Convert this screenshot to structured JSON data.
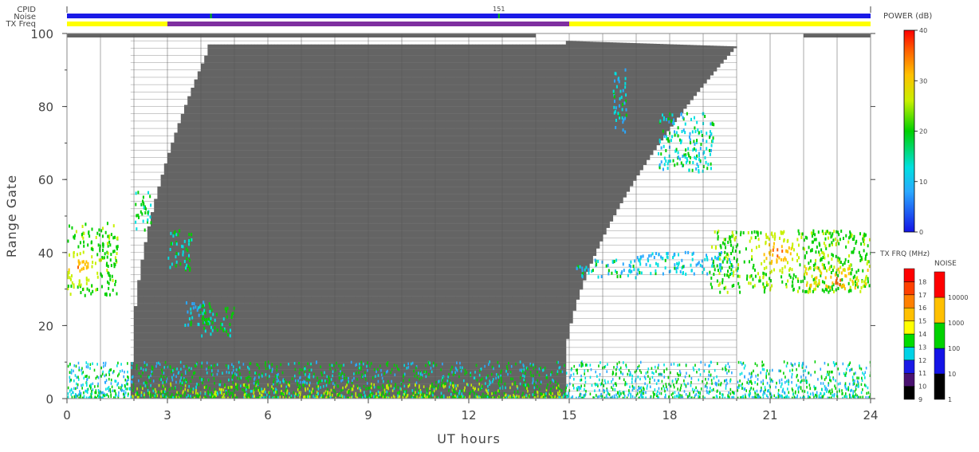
{
  "chart_data": {
    "type": "heatmap",
    "title": "",
    "xlabel": "UT hours",
    "ylabel": "Range Gate",
    "xlim": [
      0,
      24
    ],
    "ylim": [
      0,
      100
    ],
    "x_ticks": [
      0,
      3,
      6,
      9,
      12,
      15,
      18,
      21,
      24
    ],
    "y_ticks": [
      0,
      20,
      40,
      60,
      80,
      100
    ],
    "grid_x_step_hours": 1,
    "header": {
      "cpid_label": "CPID",
      "noise_label": "Noise",
      "txfreq_label": "TX Freq",
      "cpid_value": "151",
      "cpid_value_time": 12.9,
      "txfreq_segments": [
        {
          "start": 0,
          "end": 3,
          "color": "#ffff00"
        },
        {
          "start": 3,
          "end": 15,
          "color": "#7f2fa0"
        },
        {
          "start": 15,
          "end": 24,
          "color": "#ffff00"
        }
      ],
      "noise_spikes": [
        4.3,
        12.9
      ]
    },
    "ground_scatter": {
      "color": "#646464",
      "description": "Ground scatter region (grey)",
      "start_hour": 1.9,
      "end_hour": 14.8,
      "top_bar_segments": [
        [
          0,
          14
        ],
        [
          22,
          24
        ]
      ]
    },
    "echo_patches": [
      {
        "t0": 0.0,
        "t1": 1.5,
        "g0": 28,
        "g1": 48,
        "level": 18,
        "peak": 32,
        "peak_t": 0.35,
        "peak_g": 36
      },
      {
        "t0": 3.0,
        "t1": 3.7,
        "g0": 35,
        "g1": 46,
        "level": 12
      },
      {
        "t0": 3.5,
        "t1": 4.3,
        "g0": 20,
        "g1": 27,
        "level": 11
      },
      {
        "t0": 4.0,
        "t1": 5.0,
        "g0": 17,
        "g1": 25,
        "level": 15
      },
      {
        "t0": 2.0,
        "t1": 2.5,
        "g0": 46,
        "g1": 57,
        "level": 14
      },
      {
        "t0": 15.2,
        "t1": 17.2,
        "g0": 33,
        "g1": 38,
        "level": 10
      },
      {
        "t0": 17.0,
        "t1": 20.0,
        "g0": 34,
        "g1": 40,
        "level": 9
      },
      {
        "t0": 19.2,
        "t1": 24.0,
        "g0": 29,
        "g1": 46,
        "level": 18,
        "peak": 34,
        "peak_t": 21.2,
        "peak_g": 40
      },
      {
        "t0": 22.0,
        "t1": 24.0,
        "g0": 30,
        "g1": 36,
        "level": 26,
        "peak": 34,
        "peak_t": 23.0,
        "peak_g": 32
      },
      {
        "t0": 16.3,
        "t1": 16.7,
        "g0": 72,
        "g1": 90,
        "level": 9
      },
      {
        "t0": 17.6,
        "t1": 19.3,
        "g0": 62,
        "g1": 78,
        "level": 11
      }
    ],
    "low_gate_band": {
      "g0": 0,
      "g1": 10,
      "t0": 0.0,
      "t1": 24.0,
      "level": 12
    },
    "power_colorbar": {
      "title": "POWER (dB)",
      "min": 0,
      "max": 40,
      "ticks": [
        0,
        10,
        20,
        30,
        40
      ]
    },
    "freq_colorbar": {
      "title": "TX FRQ (MHz)",
      "levels": [
        "9",
        "10",
        "11",
        "12",
        "13",
        "14",
        "15",
        "16",
        "17",
        "18"
      ],
      "colors": [
        "#000000",
        "#4a1270",
        "#1a1ae6",
        "#00d2e6",
        "#00dc00",
        "#ffff00",
        "#ffc000",
        "#ff8000",
        "#ff4000",
        "#ff0000"
      ]
    },
    "noise_colorbar": {
      "title": "NOISE",
      "levels": [
        "1",
        "10",
        "100",
        "1000",
        "10000"
      ],
      "colors": [
        "#000000",
        "#1414e6",
        "#00d200",
        "#ffc000",
        "#ff0000"
      ]
    }
  }
}
